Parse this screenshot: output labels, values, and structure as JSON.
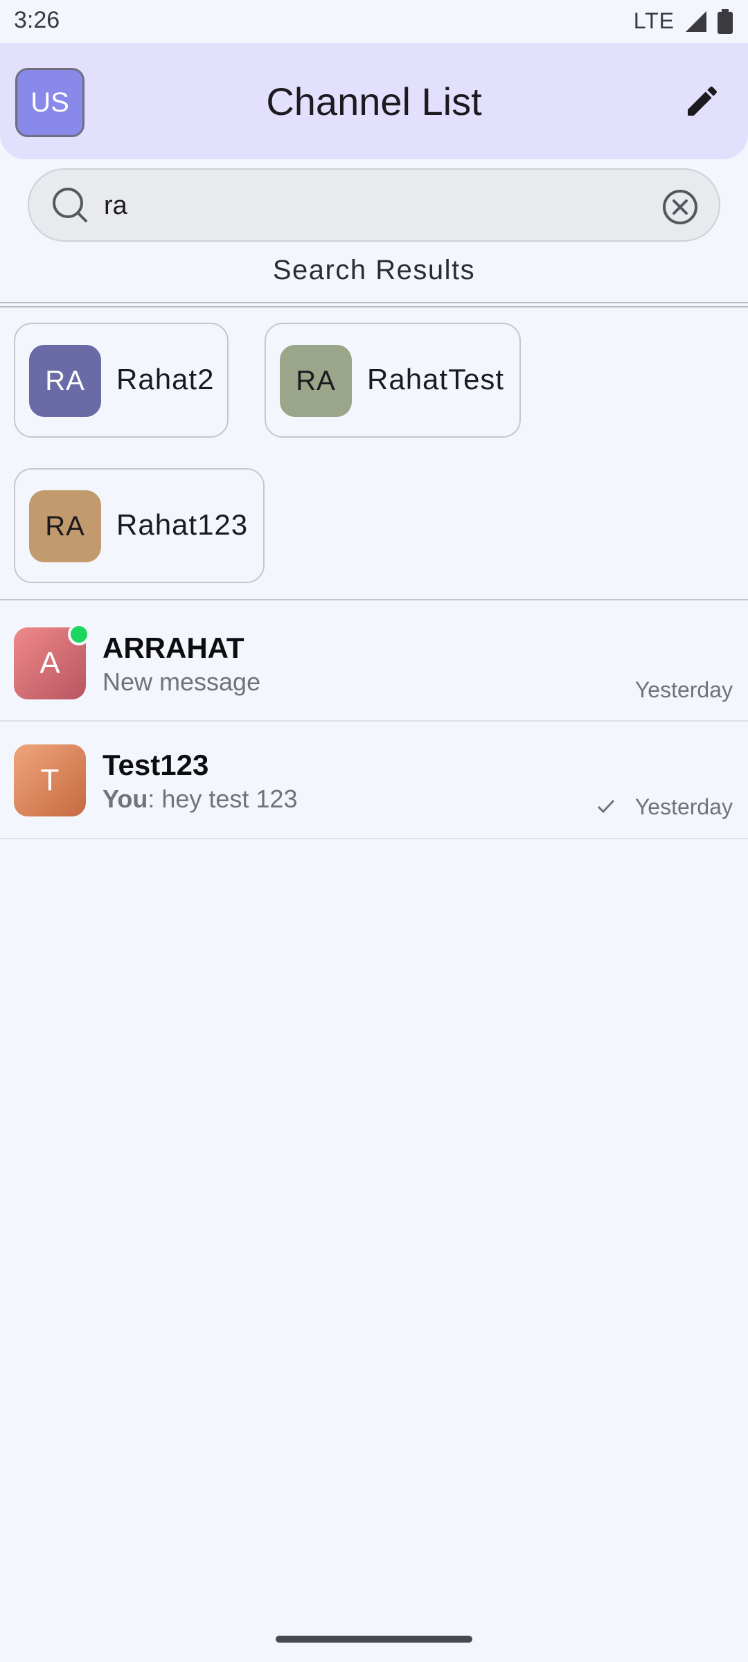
{
  "status_bar": {
    "time": "3:26",
    "network": "LTE"
  },
  "header": {
    "user_initials": "US",
    "title": "Channel List"
  },
  "search": {
    "query": "ra",
    "placeholder": "Search"
  },
  "results": {
    "title": "Search Results",
    "items": [
      {
        "initials": "RA",
        "name": "Rahat2",
        "color": "#6a6aa6",
        "text_color": "#ffffff"
      },
      {
        "initials": "RA",
        "name": "RahatTest",
        "color": "#9aa58a",
        "text_color": "#1b1b1f"
      },
      {
        "initials": "RA",
        "name": "Rahat123",
        "color": "#c19a6d",
        "text_color": "#1b1b1f"
      }
    ]
  },
  "channels": [
    {
      "initial": "A",
      "name": "ARRAHAT",
      "preview_sender": "",
      "preview": "New message",
      "time": "Yesterday",
      "online": true,
      "read": false,
      "colors": [
        "#ee8a8a",
        "#b85560"
      ]
    },
    {
      "initial": "T",
      "name": "Test123",
      "preview_sender": "You",
      "preview": ": hey test 123",
      "time": "Yesterday",
      "online": false,
      "read": true,
      "colors": [
        "#f0a57b",
        "#c56a42"
      ]
    }
  ],
  "colors": {
    "header_bg": "#e3e0fd",
    "avatar_bg": "#8889e8",
    "page_bg": "#f4f6fd",
    "online": "#1bd760"
  },
  "icons": [
    "search-icon",
    "clear-icon",
    "edit-icon",
    "signal-icon",
    "battery-icon",
    "check-icon"
  ]
}
